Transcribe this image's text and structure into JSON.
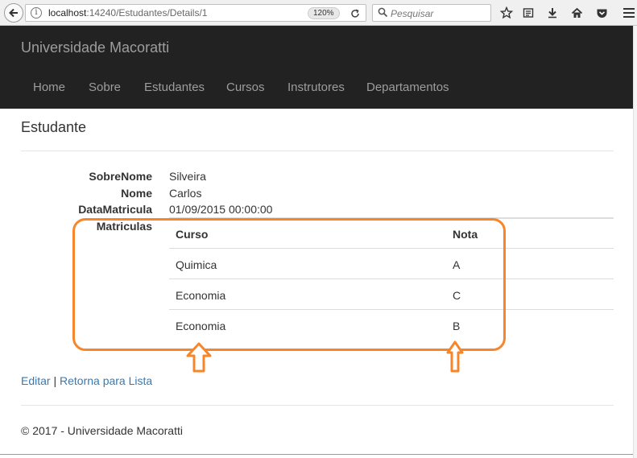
{
  "browser": {
    "url_host": "localhost",
    "url_path": ":14240/Estudantes/Details/1",
    "zoom": "120%",
    "search_placeholder": "Pesquisar",
    "icons": [
      "back-arrow-icon",
      "info-icon",
      "reload-icon",
      "search-icon",
      "star-icon",
      "reader-view-icon",
      "download-icon",
      "home-icon",
      "pocket-icon",
      "hamburger-menu-icon"
    ]
  },
  "navbar": {
    "brand": "Universidade Macoratti",
    "items": [
      "Home",
      "Sobre",
      "Estudantes",
      "Cursos",
      "Instrutores",
      "Departamentos"
    ]
  },
  "page": {
    "title": "Estudante",
    "fields": [
      {
        "label": "SobreNome",
        "value": "Silveira"
      },
      {
        "label": "Nome",
        "value": "Carlos"
      },
      {
        "label": "DataMatricula",
        "value": "01/09/2015 00:00:00"
      },
      {
        "label": "Matriculas",
        "value": ""
      }
    ],
    "enrollments": {
      "headers": [
        "Curso",
        "Nota"
      ],
      "rows": [
        [
          "Quimica",
          "A"
        ],
        [
          "Economia",
          "C"
        ],
        [
          "Economia",
          "B"
        ]
      ]
    },
    "actions": {
      "edit": "Editar",
      "separator": "|",
      "back": "Retorna para Lista"
    }
  },
  "footer": {
    "text": "© 2017 - Universidade Macoratti"
  },
  "colors": {
    "navbar_bg": "#222222",
    "nav_text": "#9d9d9d",
    "link": "#337ab7",
    "highlight": "#f7862b"
  }
}
